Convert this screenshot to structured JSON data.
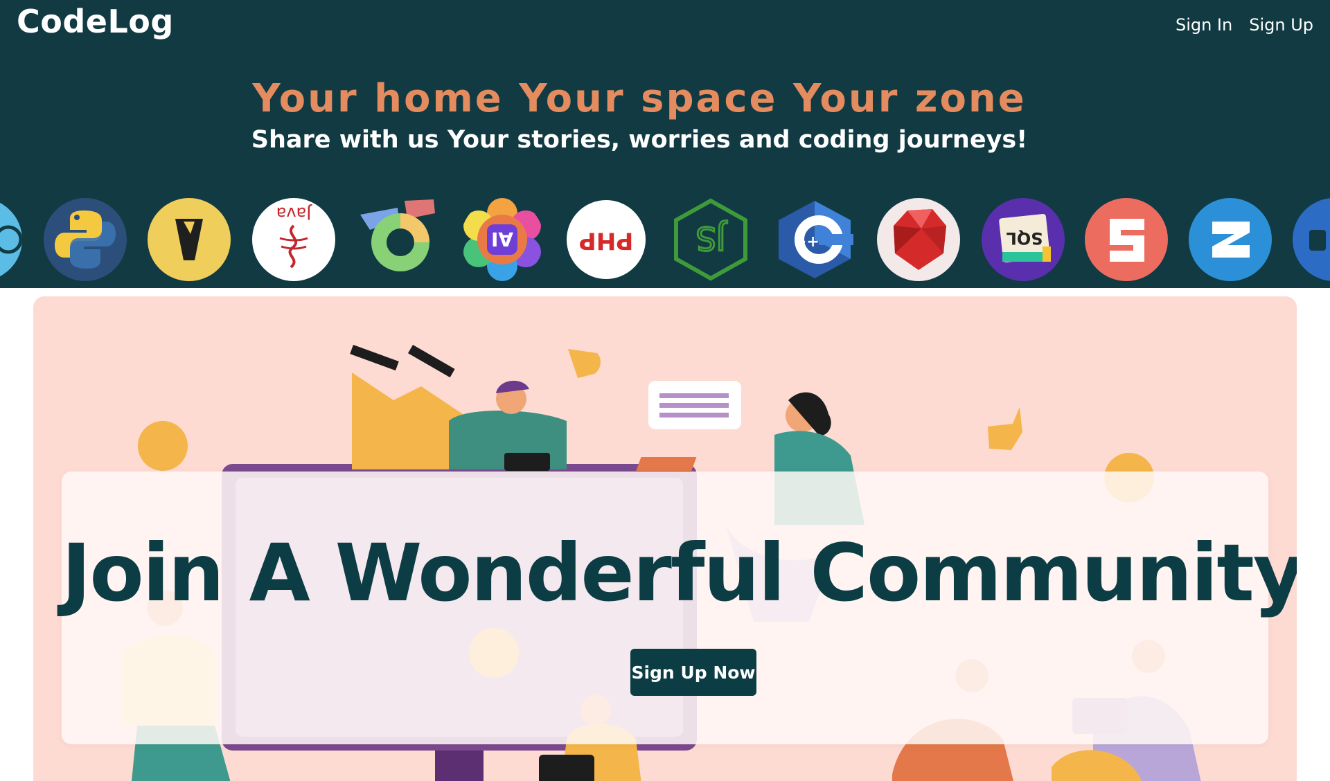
{
  "header": {
    "logo": "CodeLog",
    "nav": {
      "sign_in": "Sign In",
      "sign_up": "Sign Up"
    },
    "tagline": "Your home Your space Your zone",
    "subtagline": "Share with us Your stories, worries and coding journeys!"
  },
  "carousel": {
    "icons": [
      {
        "name": "partial-icon",
        "label": ""
      },
      {
        "name": "python-icon",
        "label": ""
      },
      {
        "name": "bulb-icon",
        "label": ""
      },
      {
        "name": "java-icon",
        "label": "Java"
      },
      {
        "name": "ring-icon",
        "label": ""
      },
      {
        "name": "ai-flower-icon",
        "label": "AI"
      },
      {
        "name": "php-icon",
        "label": "PHP"
      },
      {
        "name": "nodejs-icon",
        "label": "JS"
      },
      {
        "name": "cpp-icon",
        "label": "++"
      },
      {
        "name": "ruby-icon",
        "label": ""
      },
      {
        "name": "sql-icon",
        "label": "SQL"
      },
      {
        "name": "s-logo-icon",
        "label": ""
      },
      {
        "name": "z-logo-icon",
        "label": ""
      },
      {
        "name": "partial-icon-right",
        "label": ""
      }
    ]
  },
  "hero": {
    "headline": "Join A Wonderful Community",
    "cta": "Sign Up Now"
  },
  "colors": {
    "header_bg": "#113a42",
    "accent": "#e48c5f",
    "hero_bg": "#fddbd3",
    "headline": "#0d3d44"
  }
}
